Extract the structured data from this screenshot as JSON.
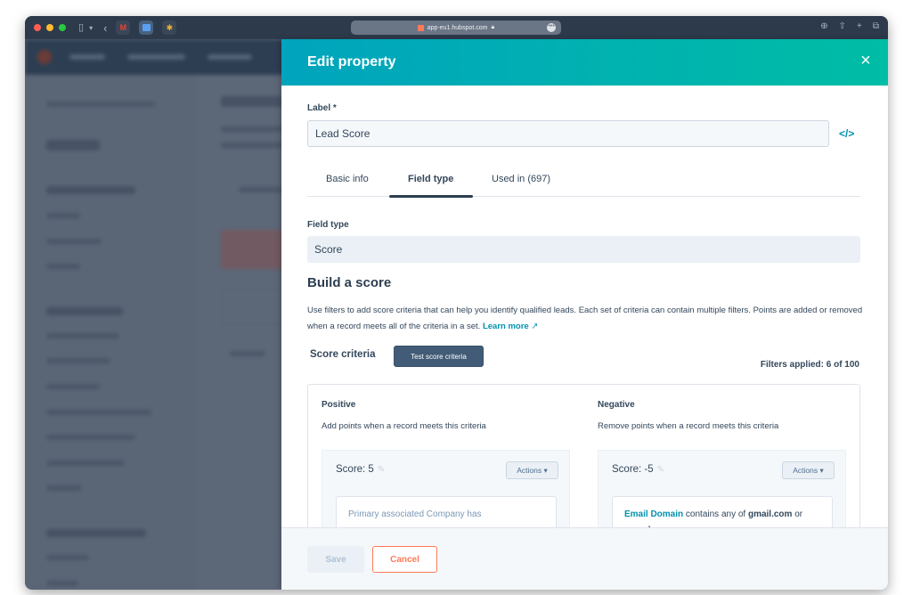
{
  "browser": {
    "address": "app-eu1.hubspot.com",
    "traffic_colors": {
      "close": "#ff5f57",
      "minimize": "#febc2e",
      "maximize": "#28c840"
    },
    "icons": {
      "sidebar": "sidebar-icon",
      "back": "‹",
      "tabs": [
        "gmail-icon",
        "calendar-icon",
        "slack-icon"
      ],
      "right": [
        "download-icon",
        "share-icon",
        "new-tab-icon",
        "tab-overview-icon"
      ]
    }
  },
  "modal": {
    "title": "Edit property",
    "close_icon": "×",
    "label_title": "Label *",
    "label_value": "Lead Score",
    "code_icon": "</>",
    "tabs": [
      {
        "label": "Basic info",
        "active": false
      },
      {
        "label": "Field type",
        "active": true
      },
      {
        "label": "Used in (697)",
        "active": false
      }
    ],
    "field_type_title": "Field type",
    "field_type_value": "Score",
    "build_title": "Build a score",
    "build_desc": "Use filters to add score criteria that can help you identify qualified leads. Each set of criteria can contain multiple filters. Points are added or removed when a record meets all of the criteria in a set.",
    "learn_more": "Learn more",
    "score_criteria_title": "Score criteria",
    "test_button": "Test score criteria",
    "filters_applied": "Filters applied: 6 of 100",
    "positive": {
      "title": "Positive",
      "desc": "Add points when a record meets this criteria",
      "score_label": "Score: 5",
      "actions": "Actions ▾",
      "filter_text": "Primary associated Company has"
    },
    "negative": {
      "title": "Negative",
      "desc": "Remove points when a record meets this criteria",
      "score_label": "Score: -5",
      "actions": "Actions ▾",
      "filter_property": "Email Domain",
      "filter_operator": " contains any of ",
      "filter_value1": "gmail.com",
      "filter_joiner": " or ",
      "filter_value2": "gmx.de"
    },
    "footer": {
      "save": "Save",
      "cancel": "Cancel"
    }
  },
  "colors": {
    "header_gradient_start": "#00a4bd",
    "header_gradient_end": "#00bda5",
    "link": "#0091ae",
    "cancel": "#ff7a59",
    "primary_text": "#33475b"
  }
}
